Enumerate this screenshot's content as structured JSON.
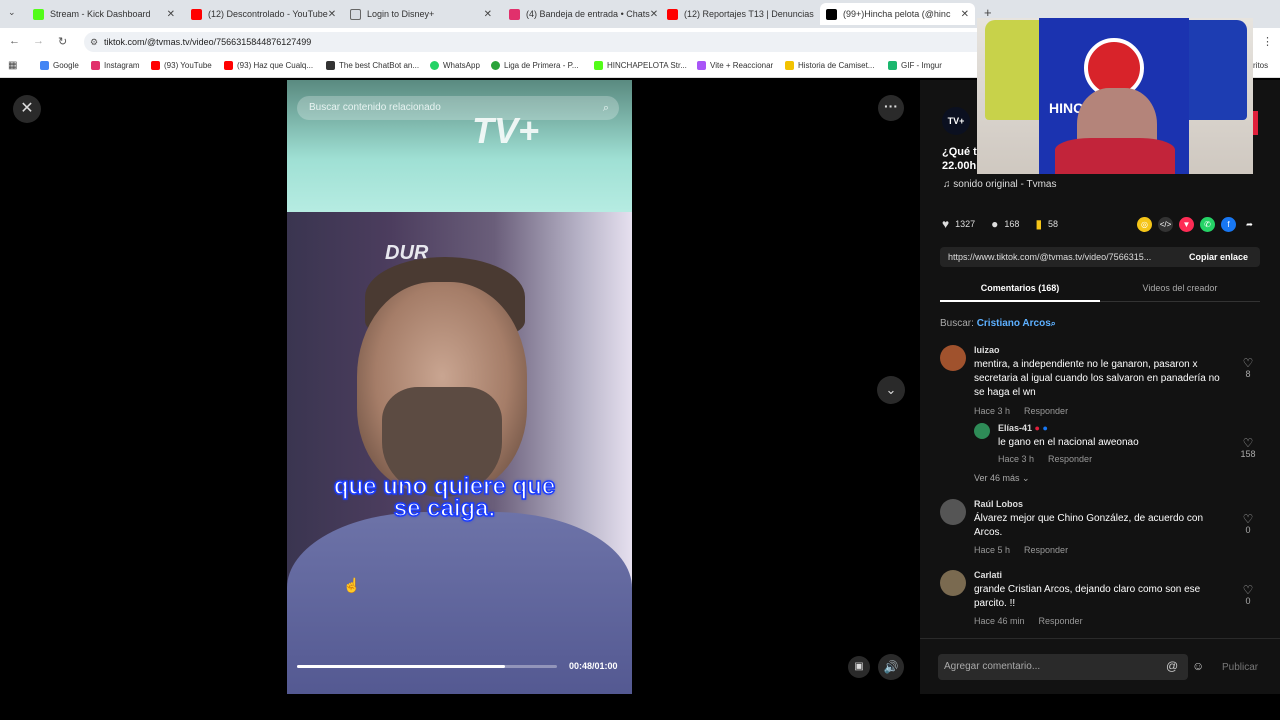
{
  "browser": {
    "tabs": [
      {
        "label": "Stream - Kick Dashboard",
        "icon": "kick-icon",
        "color": "#53fc18",
        "active": false
      },
      {
        "label": "(12) Descontrolado - YouTube",
        "icon": "youtube-icon",
        "color": "#ff0000",
        "active": false
      },
      {
        "label": "Login to Disney+",
        "icon": "disney-icon",
        "color": "#1e3a8a",
        "active": false
      },
      {
        "label": "(4) Bandeja de entrada • Chats",
        "icon": "instagram-icon",
        "color": "#e1306c",
        "active": false
      },
      {
        "label": "(12) Reportajes T13 | Denuncias",
        "icon": "youtube-icon",
        "color": "#ff0000",
        "active": false
      },
      {
        "label": "(99+)Hincha pelota (@hinc",
        "icon": "tiktok-icon",
        "color": "#000000",
        "active": true
      }
    ],
    "url": "tiktok.com/@tvmas.tv/video/7566315844876127499",
    "bookmarks": [
      {
        "label": "Google",
        "color": "#4285f4"
      },
      {
        "label": "Instagram",
        "color": "#e1306c"
      },
      {
        "label": "(93) YouTube",
        "color": "#ff0000"
      },
      {
        "label": "(93) Haz que Cualq...",
        "color": "#ff0000"
      },
      {
        "label": "The best ChatBot an...",
        "color": "#333333"
      },
      {
        "label": "WhatsApp",
        "color": "#25d366"
      },
      {
        "label": "Liga de Primera - P...",
        "color": "#2aa33a"
      },
      {
        "label": "HINCHAPELOTA Str...",
        "color": "#53fc18"
      },
      {
        "label": "Vite + Reaccionar",
        "color": "#a855f7"
      },
      {
        "label": "Historia de Camiset...",
        "color": "#f2c200"
      },
      {
        "label": "GIF - Imgur",
        "color": "#1bb76e"
      },
      {
        "label": "ritos",
        "color": "#ffffff"
      }
    ]
  },
  "video": {
    "search_placeholder": "Buscar contenido relacionado",
    "brand": "TV+",
    "set_text": "DUR",
    "subtitle_line1": "que uno quiere que",
    "subtitle_line2": "se caiga.",
    "time": "00:48/01:00",
    "progress_fraction": 0.8
  },
  "panel": {
    "creator_avatar": "TV+",
    "description": "¿Qué t\n22.00h",
    "sound": "sonido original - Tvmas",
    "likes": "1327",
    "comments_count": "168",
    "saves": "58",
    "link": "https://www.tiktok.com/@tvmas.tv/video/7566315...",
    "copy_label": "Copiar enlace",
    "tab_comments": "Comentarios (168)",
    "tab_creator_videos": "Videos del creador",
    "search_prefix": "Buscar:",
    "search_term": "Cristiano Arcos",
    "comments": [
      {
        "user": "luizao",
        "text": "mentira, a independiente no le ganaron, pasaron x secretaria al igual cuando los salvaron en panadería no se haga el wn",
        "time": "Hace 3 h",
        "reply": "Responder",
        "likes": "8",
        "avatar_color": "#a0522d"
      },
      {
        "user": "Elías-41",
        "text": "le gano en el nacional aweonao",
        "time": "Hace 3 h",
        "reply": "Responder",
        "likes": "158",
        "avatar_color": "#2e8b57"
      },
      {
        "user": "Raúl Lobos",
        "text": "Álvarez mejor que Chino González, de acuerdo con Arcos.",
        "time": "Hace 5 h",
        "reply": "Responder",
        "likes": "0",
        "avatar_color": "#555555"
      },
      {
        "user": "Carlati",
        "text": "grande Cristian Arcos, dejando claro como son ese parcito. !!",
        "time": "Hace 46 min",
        "reply": "Responder",
        "likes": "0",
        "avatar_color": "#7a6a50"
      }
    ],
    "see_more": "Ver 46 más",
    "comment_placeholder": "Agregar comentario...",
    "post_label": "Publicar"
  },
  "webcam": {
    "flag_text": "HINCHA"
  }
}
